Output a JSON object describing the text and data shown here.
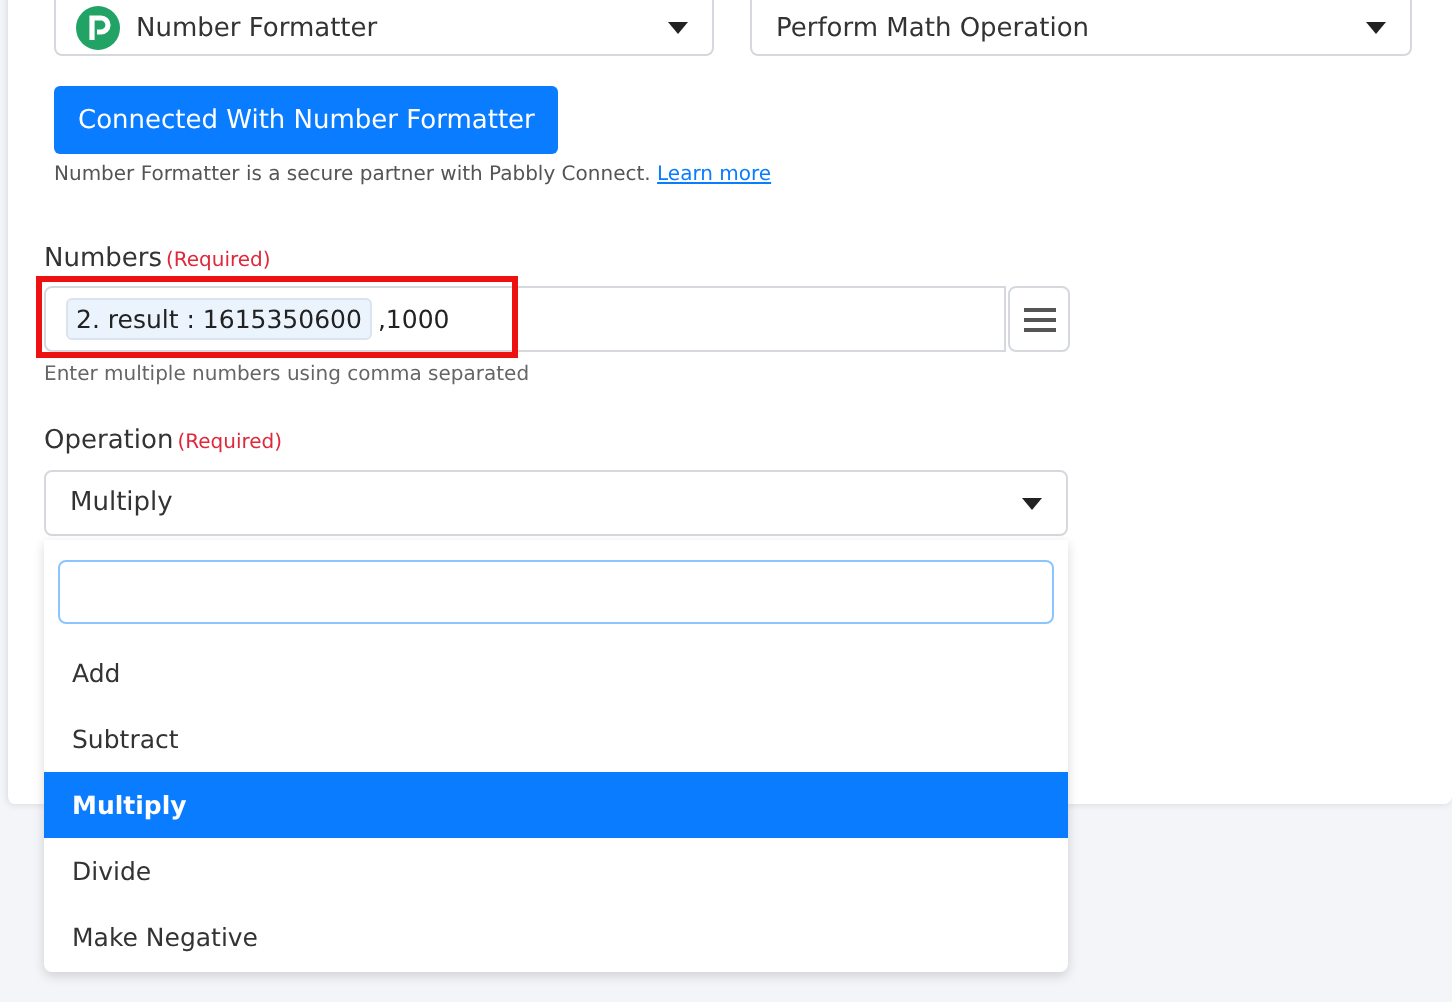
{
  "app_select": {
    "value": "Number Formatter"
  },
  "action_select": {
    "value": "Perform Math Operation"
  },
  "connect_button": {
    "label": "Connected With Number Formatter"
  },
  "partner_note": {
    "text": "Number Formatter is a secure partner with Pabbly Connect.",
    "link": "Learn more"
  },
  "numbers": {
    "label": "Numbers",
    "required": "(Required)",
    "token": "2. result : 1615350600",
    "value": ",1000",
    "hint": "Enter multiple numbers using comma separated",
    "highlighted": true
  },
  "operation": {
    "label": "Operation",
    "required": "(Required)",
    "value": "Multiply",
    "dropdown": {
      "options": [
        {
          "label": "Add",
          "selected": false
        },
        {
          "label": "Subtract",
          "selected": false
        },
        {
          "label": "Multiply",
          "selected": true
        },
        {
          "label": "Divide",
          "selected": false
        },
        {
          "label": "Make Negative",
          "selected": false
        }
      ]
    }
  }
}
